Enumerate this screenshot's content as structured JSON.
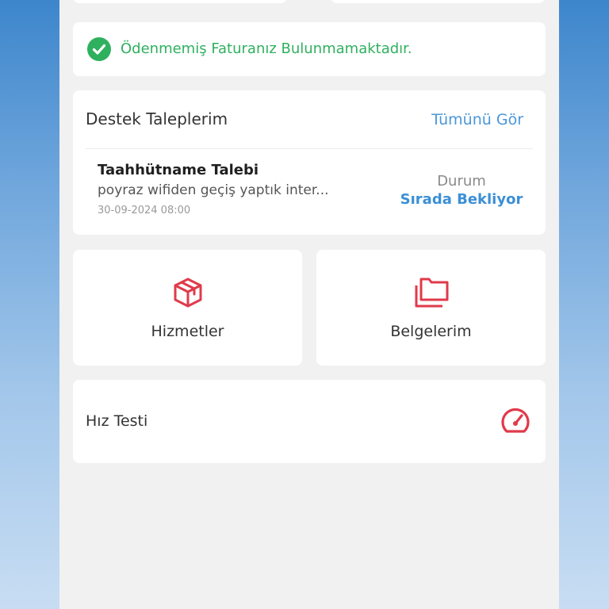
{
  "invoice": {
    "message": "Ödenmemiş Faturanız Bulunmamaktadır.",
    "icon": "check-circle-icon",
    "color": "#2fb05f"
  },
  "support": {
    "title": "Destek Taleplerim",
    "see_all": "Tümünü Gör",
    "ticket": {
      "title": "Taahhütname Talebi",
      "description": "poyraz wifiden geçiş yaptık inter...",
      "date": "30-09-2024 08:00",
      "status_label": "Durum",
      "status_value": "Sırada Bekliyor"
    }
  },
  "tiles": {
    "services": {
      "label": "Hizmetler",
      "icon": "box-icon"
    },
    "documents": {
      "label": "Belgelerim",
      "icon": "folders-icon"
    }
  },
  "speed_test": {
    "label": "Hız Testi",
    "icon": "speedometer-icon"
  },
  "colors": {
    "accent": "#e03a4b",
    "link": "#4a97d9",
    "success": "#2fb05f"
  }
}
